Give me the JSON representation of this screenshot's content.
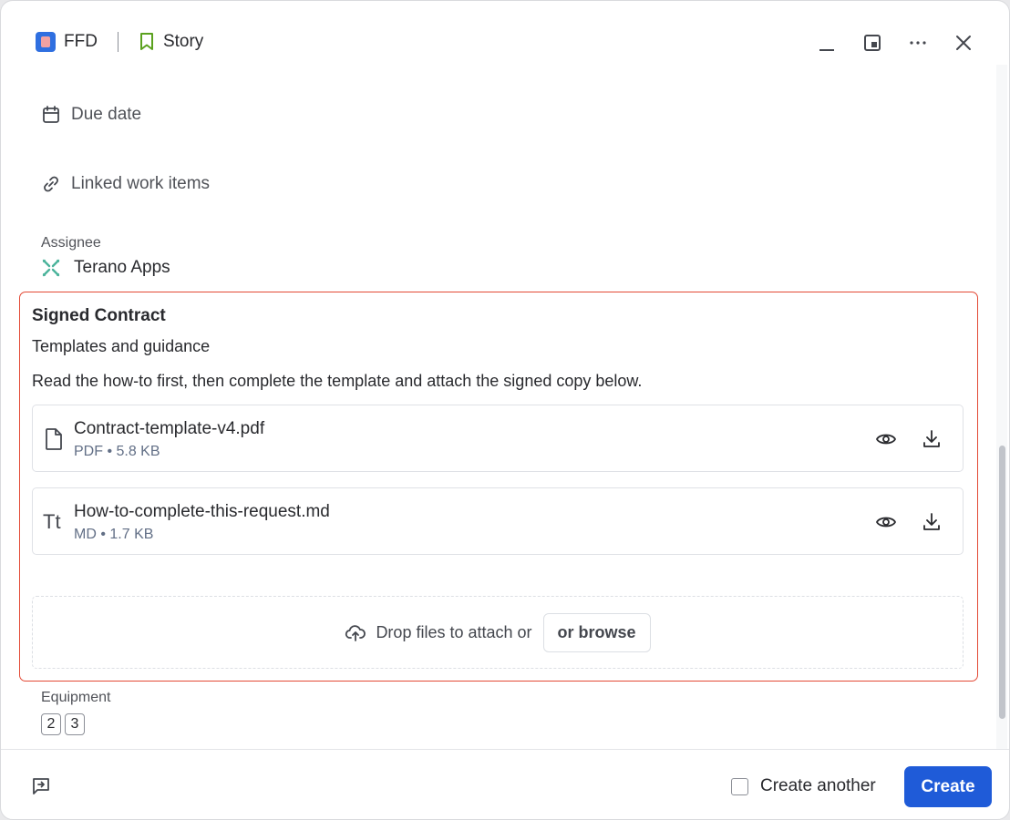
{
  "header": {
    "project_name": "FFD",
    "issue_type": "Story",
    "actions": [
      "minimize-icon",
      "expand-icon",
      "more-icon",
      "close-icon"
    ]
  },
  "fields": {
    "due_date_label": "Due date",
    "linked_items_label": "Linked work items",
    "assignee_label": "Assignee",
    "assignee_name": "Terano Apps",
    "equipment_label": "Equipment",
    "equipment_values": [
      "2",
      "3"
    ]
  },
  "section": {
    "title": "Signed Contract",
    "subtitle": "Templates and guidance",
    "description": "Read the how-to first, then complete the template and attach the signed copy below.",
    "files": [
      {
        "name": "Contract-template-v4.pdf",
        "meta": "PDF • 5.8 KB",
        "icon": "file-icon"
      },
      {
        "name": "How-to-complete-this-request.md",
        "meta": "MD • 1.7 KB",
        "icon": "text-format-icon",
        "icon_text": "Tt"
      }
    ],
    "dropzone_text": "Drop files to attach or",
    "browse_label": "or browse"
  },
  "footer": {
    "create_another_label": "Create another",
    "create_another_checked": false,
    "create_label": "Create"
  },
  "colors": {
    "primary": "#1f5bd8",
    "highlight_border": "#e34935",
    "assignee_icon": "#4bb39b"
  }
}
